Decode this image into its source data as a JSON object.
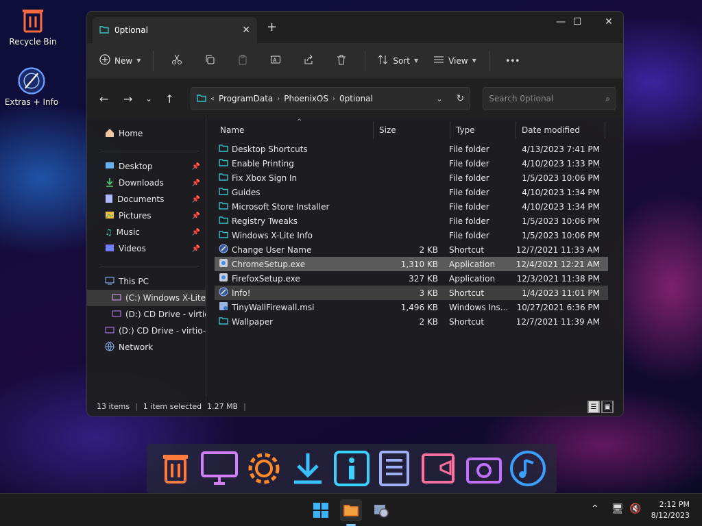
{
  "desktop": {
    "icons": [
      {
        "label": "Recycle Bin"
      },
      {
        "label": "Extras + Info"
      }
    ]
  },
  "window": {
    "tab_title": "0ptional",
    "tab_close": "✕",
    "new_tab": "+",
    "minimize": "—",
    "maximize": "☐",
    "close": "✕"
  },
  "toolbar": {
    "new_label": "New",
    "sort_label": "Sort",
    "view_label": "View",
    "more": "•••"
  },
  "address": {
    "prefix": "«",
    "crumbs": [
      "ProgramData",
      "PhoenixOS",
      "0ptional"
    ],
    "search_placeholder": "Search 0ptional"
  },
  "sidebar": {
    "home": "Home",
    "quick": [
      "Desktop",
      "Downloads",
      "Documents",
      "Pictures",
      "Music",
      "Videos"
    ],
    "this_pc": "This PC",
    "drives": [
      "(C:) Windows X-Lite",
      "(D:) CD Drive - virtio"
    ],
    "cd_drive": "(D:) CD Drive - virtio-w",
    "network": "Network"
  },
  "columns": {
    "name": "Name",
    "size": "Size",
    "type": "Type",
    "date": "Date modified"
  },
  "files": [
    {
      "name": "Desktop Shortcuts",
      "size": "",
      "type": "File folder",
      "date": "4/13/2023 7:41 PM",
      "kind": "folder"
    },
    {
      "name": "Enable Printing",
      "size": "",
      "type": "File folder",
      "date": "4/10/2023 1:33 PM",
      "kind": "folder"
    },
    {
      "name": "Fix Xbox Sign In",
      "size": "",
      "type": "File folder",
      "date": "1/5/2023 10:06 PM",
      "kind": "folder"
    },
    {
      "name": "Guides",
      "size": "",
      "type": "File folder",
      "date": "4/10/2023 1:34 PM",
      "kind": "folder"
    },
    {
      "name": "Microsoft Store Installer",
      "size": "",
      "type": "File folder",
      "date": "4/10/2023 1:34 PM",
      "kind": "folder"
    },
    {
      "name": "Registry Tweaks",
      "size": "",
      "type": "File folder",
      "date": "1/5/2023 10:06 PM",
      "kind": "folder"
    },
    {
      "name": "Windows X-Lite Info",
      "size": "",
      "type": "File folder",
      "date": "1/5/2023 10:06 PM",
      "kind": "folder"
    },
    {
      "name": "Change User Name",
      "size": "2 KB",
      "type": "Shortcut",
      "date": "12/7/2021 11:33 AM",
      "kind": "shortcut"
    },
    {
      "name": "ChromeSetup.exe",
      "size": "1,310 KB",
      "type": "Application",
      "date": "12/4/2021 12:21 AM",
      "kind": "app"
    },
    {
      "name": "FirefoxSetup.exe",
      "size": "327 KB",
      "type": "Application",
      "date": "12/3/2021 11:38 PM",
      "kind": "app"
    },
    {
      "name": "Info!",
      "size": "3 KB",
      "type": "Shortcut",
      "date": "1/4/2023 11:01 PM",
      "kind": "shortcut"
    },
    {
      "name": "TinyWallFirewall.msi",
      "size": "1,496 KB",
      "type": "Windows Ins...",
      "date": "10/27/2021 6:36 PM",
      "kind": "msi"
    },
    {
      "name": "Wallpaper",
      "size": "2 KB",
      "type": "Shortcut",
      "date": "12/7/2021 11:39 AM",
      "kind": "folder"
    }
  ],
  "status": {
    "count": "13 items",
    "selected": "1 item selected",
    "size": "1.27 MB"
  },
  "taskbar": {
    "time": "2:12 PM",
    "date": "8/12/2023"
  },
  "colors": {
    "accent": "#2ec8c8",
    "folder": "#36c2c8"
  }
}
